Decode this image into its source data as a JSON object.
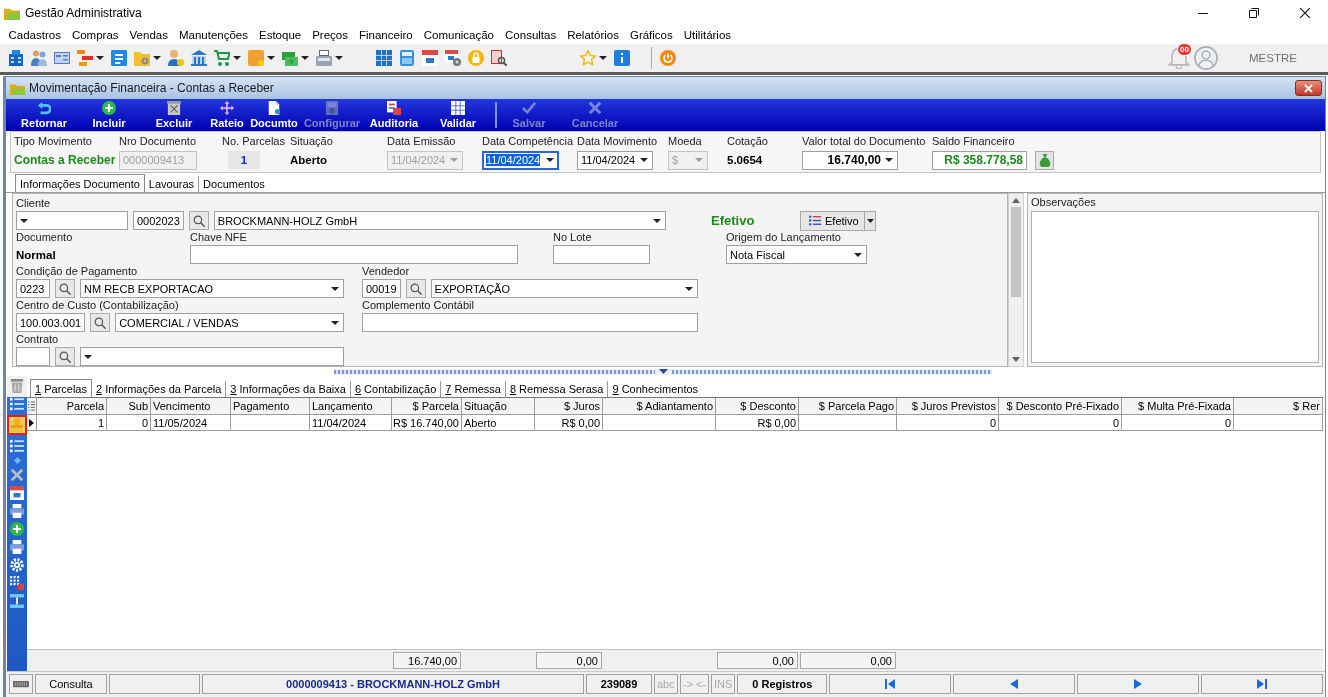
{
  "app": {
    "title": "Gestão Administrativa"
  },
  "menu": [
    "Cadastros",
    "Compras",
    "Vendas",
    "Manutenções",
    "Estoque",
    "Preços",
    "Financeiro",
    "Comunicação",
    "Consultas",
    "Relatórios",
    "Gráficos",
    "Utilitários"
  ],
  "user_bar": {
    "notifications": "00",
    "user": "MESTRE"
  },
  "window": {
    "title": "Movimentação Financeira - Contas a Receber"
  },
  "actions": [
    {
      "label": "Retornar",
      "disabled": false
    },
    {
      "label": "Incluir",
      "disabled": false
    },
    {
      "label": "Excluir",
      "disabled": false
    },
    {
      "label": "Rateio",
      "disabled": false
    },
    {
      "label": "Documto",
      "disabled": false
    },
    {
      "label": "Configurar",
      "disabled": true
    },
    {
      "label": "Auditoria",
      "disabled": false
    },
    {
      "label": "Validar",
      "disabled": false
    },
    {
      "label": "Salvar",
      "disabled": true
    },
    {
      "label": "Cancelar",
      "disabled": true
    }
  ],
  "header": [
    {
      "label": "Tipo Movimento",
      "kind": "status",
      "value": "Contas a Receber"
    },
    {
      "label": "Nro Documento",
      "kind": "input",
      "value": "0000009413",
      "disabled": true
    },
    {
      "label": "No. Parcelas",
      "kind": "count",
      "value": "1"
    },
    {
      "label": "Situação",
      "kind": "text",
      "value": "Aberto"
    },
    {
      "label": "Data Emissão",
      "kind": "combo",
      "value": "11/04/2024",
      "disabled": true,
      "focused": false
    },
    {
      "label": "Data Competência",
      "kind": "combo",
      "value": "11/04/2024",
      "disabled": false,
      "focused": true
    },
    {
      "label": "Data Movimento",
      "kind": "combo",
      "value": "11/04/2024",
      "disabled": false,
      "focused": false
    },
    {
      "label": "Moeda",
      "kind": "combo",
      "value": "$",
      "disabled": true,
      "focused": false
    },
    {
      "label": "Cotação",
      "kind": "text",
      "value": "5.0654"
    },
    {
      "label": "Valor total do Documento",
      "kind": "amount",
      "value": "16.740,00",
      "disabled": false,
      "focused": false
    },
    {
      "label": "Saldo Financeiro",
      "kind": "balance",
      "value": "R$ 358.778,58"
    }
  ],
  "doc_tabs": [
    {
      "label": "Informações Documento",
      "selected": true
    },
    {
      "label": "Lavouras",
      "selected": false
    },
    {
      "label": "Documentos",
      "selected": false
    }
  ],
  "form": {
    "fields": [
      {
        "label": "Cliente",
        "controls": [
          {
            "kind": "combo"
          },
          {
            "kind": "code",
            "value": "0002023"
          },
          {
            "kind": "search"
          },
          {
            "kind": "combo",
            "value": "BROCKMANN-HOLZ GmbH"
          }
        ]
      },
      {
        "controls": [
          {
            "kind": "status",
            "value": "Efetivo"
          }
        ]
      },
      {
        "controls": [
          {
            "kind": "menu_button",
            "value": "Efetivo"
          }
        ]
      },
      {
        "label": "Documento",
        "controls": [
          {
            "kind": "text",
            "value": "Normal"
          }
        ]
      },
      {
        "label": "Chave NFE",
        "controls": [
          {
            "kind": "input"
          }
        ]
      },
      {
        "label": "No Lote",
        "controls": [
          {
            "kind": "input"
          }
        ]
      },
      {
        "label": "Origem do Lançamento",
        "controls": [
          {
            "kind": "combo",
            "value": "Nota Fiscal"
          }
        ]
      },
      {
        "label": "Condição de Pagamento",
        "controls": [
          {
            "kind": "code",
            "value": "0223"
          },
          {
            "kind": "search"
          },
          {
            "kind": "combo",
            "value": "NM RECB EXPORTACAO"
          }
        ]
      },
      {
        "label": "Vendedor",
        "controls": [
          {
            "kind": "code",
            "value": "00019"
          },
          {
            "kind": "search"
          },
          {
            "kind": "combo",
            "value": "EXPORTAÇÃO"
          }
        ]
      },
      {
        "label": "Centro de Custo (Contabilização)",
        "controls": [
          {
            "kind": "code",
            "value": "100.003.001"
          },
          {
            "kind": "search"
          },
          {
            "kind": "combo",
            "value": "COMERCIAL / VENDAS"
          }
        ]
      },
      {
        "label": "Complemento Contábil",
        "controls": [
          {
            "kind": "input"
          }
        ]
      },
      {
        "label": "Contrato",
        "controls": [
          {
            "kind": "code"
          },
          {
            "kind": "search"
          },
          {
            "kind": "combo"
          }
        ]
      }
    ]
  },
  "notes": {
    "label": "Observações"
  },
  "side_toolbar": [
    {
      "selected": false
    },
    {
      "selected": false
    },
    {
      "selected": true
    },
    {
      "selected": false
    },
    {
      "selected": false
    },
    {
      "selected": false
    },
    {
      "selected": false
    },
    {
      "selected": false
    },
    {
      "selected": false
    },
    {
      "selected": false
    },
    {
      "selected": false
    },
    {
      "selected": false
    },
    {
      "selected": false
    }
  ],
  "detail_tabs": [
    {
      "key": "1",
      "label": "Parcelas",
      "selected": true
    },
    {
      "key": "2",
      "label": "Informações da Parcela",
      "selected": false
    },
    {
      "key": "3",
      "label": "Informações da Baixa",
      "selected": false
    },
    {
      "key": "6",
      "label": "Contabilização",
      "selected": false
    },
    {
      "key": "7",
      "label": "Remessa",
      "selected": false
    },
    {
      "key": "8",
      "label": "Remessa Serasa",
      "selected": false
    },
    {
      "key": "9",
      "label": "Conhecimentos",
      "selected": false
    }
  ],
  "grid": {
    "columns": [
      {
        "label": "Parcela",
        "kind": "number"
      },
      {
        "label": "Sub",
        "kind": "number"
      },
      {
        "label": "Vencimento",
        "kind": "text"
      },
      {
        "label": "Pagamento",
        "kind": "text"
      },
      {
        "label": "Lançamento",
        "kind": "text"
      },
      {
        "label": "$ Parcela",
        "kind": "number",
        "total": "16.740,00"
      },
      {
        "label": "Situação",
        "kind": "text"
      },
      {
        "label": "$ Juros",
        "kind": "number",
        "total": "0,00"
      },
      {
        "label": "$ Adiantamento",
        "kind": "number"
      },
      {
        "label": "$ Desconto",
        "kind": "number",
        "total": "0,00"
      },
      {
        "label": "$ Parcela Pago",
        "kind": "number",
        "total": "0,00"
      },
      {
        "label": "$ Juros Previstos",
        "kind": "number"
      },
      {
        "label": "$ Desconto Pré-Fixado",
        "kind": "number"
      },
      {
        "label": "$ Multa Pré-Fixada",
        "kind": "number"
      },
      {
        "label": "$ Rer",
        "kind": "number"
      }
    ],
    "rows": [
      {
        "current": true,
        "cells": [
          "1",
          "0",
          "11/05/2024",
          null,
          "11/04/2024",
          "R$ 16.740,00",
          "Aberto",
          "R$ 0,00",
          null,
          "R$ 0,00",
          null,
          "0",
          "0",
          "0",
          null
        ]
      }
    ]
  },
  "status_bar": {
    "mode": "Consulta",
    "record": "0000009413 - BROCKMANN-HOLZ GmbH",
    "code": "239089",
    "indicators": [
      {
        "label": "abc",
        "on": false
      },
      {
        "label": "-> <-",
        "on": false
      },
      {
        "label": "INS",
        "on": false
      }
    ],
    "count": "0 Registros"
  }
}
